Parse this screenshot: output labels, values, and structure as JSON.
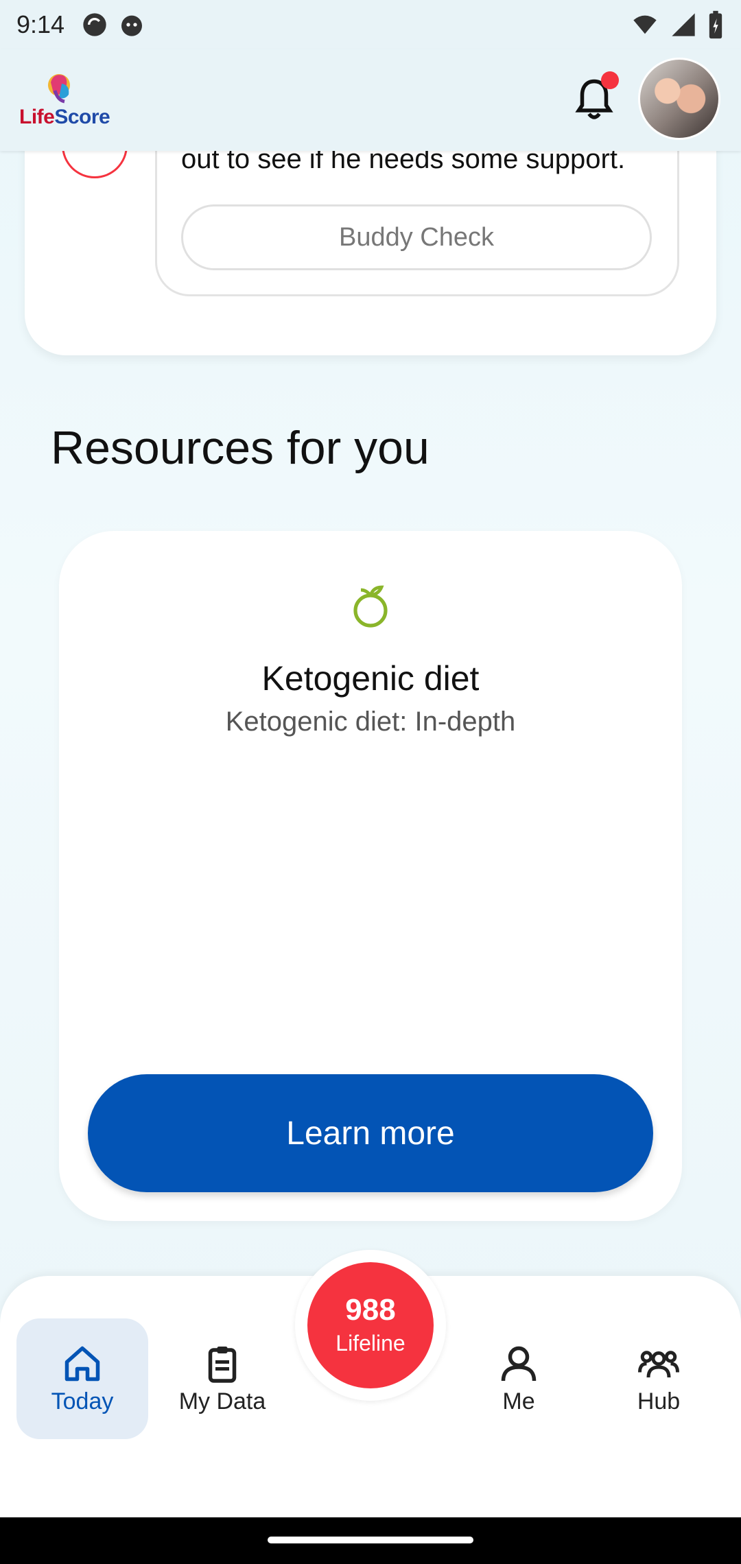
{
  "status_bar": {
    "time": "9:14"
  },
  "header": {
    "logo_life": "Life",
    "logo_score": "Score"
  },
  "support_card": {
    "text": "out to see if he needs some support.",
    "buddy_check_label": "Buddy Check"
  },
  "resources": {
    "section_title": "Resources for you",
    "card": {
      "icon": "fruit-icon",
      "title": "Ketogenic diet",
      "subtitle": "Ketogenic diet: In-depth",
      "button_label": "Learn more"
    }
  },
  "lifeline": {
    "number": "988",
    "label": "Lifeline"
  },
  "bottom_nav": {
    "items": [
      {
        "label": "Today",
        "icon": "home-icon",
        "active": true
      },
      {
        "label": "My Data",
        "icon": "clipboard-icon",
        "active": false
      },
      {
        "label": "Me",
        "icon": "person-icon",
        "active": false
      },
      {
        "label": "Hub",
        "icon": "group-icon",
        "active": false
      }
    ]
  },
  "colors": {
    "accent_blue": "#0354b5",
    "alert_red": "#f5333f"
  }
}
